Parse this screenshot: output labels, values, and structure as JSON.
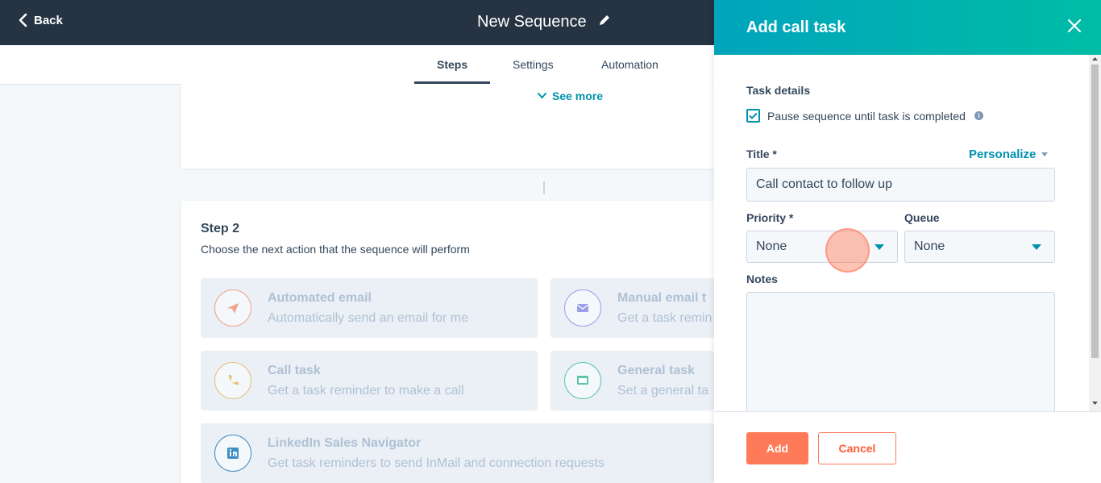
{
  "topbar": {
    "back_label": "Back",
    "title": "New Sequence"
  },
  "tabs": [
    {
      "label": "Steps",
      "active": true
    },
    {
      "label": "Settings",
      "active": false
    },
    {
      "label": "Automation",
      "active": false
    }
  ],
  "step1": {
    "see_more_label": "See more"
  },
  "step2": {
    "title": "Step 2",
    "subtitle": "Choose the next action that the sequence will perform",
    "options": [
      {
        "title": "Automated email",
        "desc": "Automatically send an email for me",
        "icon": "paper-plane-icon",
        "color": "#f2a38f"
      },
      {
        "title": "Manual email t",
        "desc": "Get a task remin",
        "icon": "envelope-icon",
        "color": "#9c9ee8"
      },
      {
        "title": "Call task",
        "desc": "Get a task reminder to make a call",
        "icon": "phone-icon",
        "color": "#e6c07a"
      },
      {
        "title": "General task",
        "desc": "Set a general ta",
        "icon": "monitor-icon",
        "color": "#5cc7a8"
      },
      {
        "title": "LinkedIn Sales Navigator",
        "desc": "Get task reminders to send InMail and connection requests",
        "icon": "linkedin-icon",
        "color": "#3f8fc4"
      }
    ]
  },
  "panel": {
    "title": "Add call task",
    "task_details_label": "Task details",
    "pause_label": "Pause sequence until task is completed",
    "pause_checked": true,
    "title_label": "Title *",
    "personalize_label": "Personalize",
    "title_value": "Call contact to follow up",
    "priority_label": "Priority *",
    "priority_value": "None",
    "queue_label": "Queue",
    "queue_value": "None",
    "notes_label": "Notes",
    "add_label": "Add",
    "cancel_label": "Cancel"
  },
  "colors": {
    "topbar": "#253342",
    "accent": "#0091ae",
    "primary_button": "#ff7a59",
    "header_gradient_start": "#00a4bd",
    "header_gradient_end": "#00bda5"
  }
}
